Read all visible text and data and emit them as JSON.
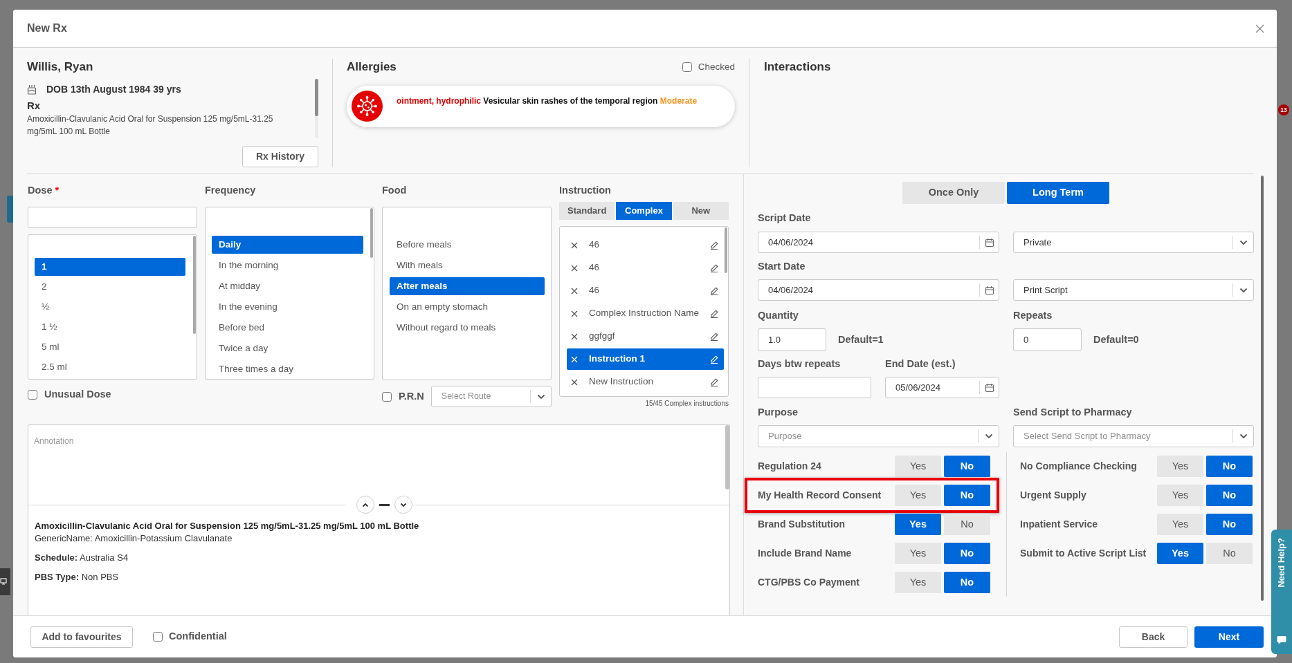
{
  "window": {
    "title": "New Rx"
  },
  "patient": {
    "name": "Willis, Ryan",
    "dob": "DOB 13th August 1984 39 yrs",
    "rx_heading": "Rx",
    "rx_description": "Amoxicillin-Clavulanic Acid Oral for Suspension 125 mg/5mL-31.25 mg/5mL 100 mL Bottle",
    "history_button": "Rx History"
  },
  "allergies": {
    "title": "Allergies",
    "checked_label": "Checked",
    "checked": false,
    "items": [
      {
        "substance": "ointment, hydrophilic",
        "reaction": "Vesicular skin rashes of the temporal region",
        "severity": "Moderate"
      }
    ]
  },
  "interactions": {
    "title": "Interactions"
  },
  "dose": {
    "label": "Dose",
    "required_mark": "*",
    "options": [
      {
        "label": "1",
        "selected": true
      },
      {
        "label": "2",
        "selected": false
      },
      {
        "label": "½",
        "selected": false
      },
      {
        "label": "1 ½",
        "selected": false
      },
      {
        "label": "5 ml",
        "selected": false
      },
      {
        "label": "2.5 ml",
        "selected": false
      }
    ],
    "unusual_label": "Unusual Dose",
    "unusual_checked": false
  },
  "frequency": {
    "label": "Frequency",
    "options": [
      {
        "label": "Daily",
        "selected": true
      },
      {
        "label": "In the morning",
        "selected": false
      },
      {
        "label": "At midday",
        "selected": false
      },
      {
        "label": "In the evening",
        "selected": false
      },
      {
        "label": "Before bed",
        "selected": false
      },
      {
        "label": "Twice a day",
        "selected": false
      },
      {
        "label": "Three times a day",
        "selected": false
      }
    ]
  },
  "food": {
    "label": "Food",
    "options": [
      {
        "label": "Before meals",
        "selected": false
      },
      {
        "label": "With meals",
        "selected": false
      },
      {
        "label": "After meals",
        "selected": true
      },
      {
        "label": "On an empty stomach",
        "selected": false
      },
      {
        "label": "Without regard to meals",
        "selected": false
      }
    ],
    "prn_label": "P.R.N",
    "prn_checked": false,
    "route_placeholder": "Select Route"
  },
  "instruction": {
    "label": "Instruction",
    "tabs": [
      {
        "label": "Standard",
        "selected": false
      },
      {
        "label": "Complex",
        "selected": true
      },
      {
        "label": "New",
        "selected": false
      }
    ],
    "items": [
      {
        "label": "46",
        "selected": false
      },
      {
        "label": "46",
        "selected": false
      },
      {
        "label": "46",
        "selected": false
      },
      {
        "label": "Complex Instruction Name",
        "selected": false
      },
      {
        "label": "ggfggf",
        "selected": false
      },
      {
        "label": "Instruction 1",
        "selected": true
      },
      {
        "label": "New Instruction",
        "selected": false
      }
    ],
    "count": "15/45 Complex instructions"
  },
  "annotation": {
    "placeholder": "Annotation"
  },
  "drug_info": {
    "name": "Amoxicillin-Clavulanic Acid Oral for Suspension 125 mg/5mL-31.25 mg/5mL 100 mL Bottle",
    "generic": "GenericName: Amoxicillin-Potassium Clavulanate",
    "details": [
      "**Schedule:** Australia S4",
      "**PBS Type:** Non PBS"
    ]
  },
  "term_tabs": [
    {
      "label": "Once Only",
      "selected": false
    },
    {
      "label": "Long Term",
      "selected": true
    }
  ],
  "script_date": {
    "label": "Script Date",
    "value": "04/06/2024"
  },
  "script_type": {
    "value": "Private"
  },
  "start_date": {
    "label": "Start Date",
    "value": "04/06/2024"
  },
  "delivery": {
    "value": "Print Script"
  },
  "quantity": {
    "label": "Quantity",
    "value": "1.0",
    "default_note": "Default=1"
  },
  "repeats": {
    "label": "Repeats",
    "value": "0",
    "default_note": "Default=0"
  },
  "days_between_repeats": {
    "label": "Days btw repeats"
  },
  "end_date": {
    "label": "End Date (est.)",
    "value": "05/06/2024"
  },
  "purpose": {
    "label": "Purpose",
    "placeholder": "Purpose"
  },
  "send_to_pharmacy": {
    "label": "Send Script to Pharmacy",
    "placeholder": "Select Send Script to Pharmacy"
  },
  "toggles_left": [
    {
      "label": "Regulation 24",
      "highlighted": false,
      "options": [
        {
          "label": "Yes",
          "selected": false
        },
        {
          "label": "No",
          "selected": true
        }
      ]
    },
    {
      "label": "My Health Record Consent",
      "highlighted": true,
      "options": [
        {
          "label": "Yes",
          "selected": false
        },
        {
          "label": "No",
          "selected": true
        }
      ]
    },
    {
      "label": "Brand Substitution",
      "highlighted": false,
      "options": [
        {
          "label": "Yes",
          "selected": true
        },
        {
          "label": "No",
          "selected": false
        }
      ]
    },
    {
      "label": "Include Brand Name",
      "highlighted": false,
      "options": [
        {
          "label": "Yes",
          "selected": false
        },
        {
          "label": "No",
          "selected": true
        }
      ]
    },
    {
      "label": "CTG/PBS Co Payment",
      "highlighted": false,
      "options": [
        {
          "label": "Yes",
          "selected": false
        },
        {
          "label": "No",
          "selected": true
        }
      ]
    }
  ],
  "toggles_right": [
    {
      "label": "No Compliance Checking",
      "highlighted": false,
      "options": [
        {
          "label": "Yes",
          "selected": false
        },
        {
          "label": "No",
          "selected": true
        }
      ]
    },
    {
      "label": "Urgent Supply",
      "highlighted": false,
      "options": [
        {
          "label": "Yes",
          "selected": false
        },
        {
          "label": "No",
          "selected": true
        }
      ]
    },
    {
      "label": "Inpatient Service",
      "highlighted": false,
      "options": [
        {
          "label": "Yes",
          "selected": false
        },
        {
          "label": "No",
          "selected": true
        }
      ]
    },
    {
      "label": "Submit to Active Script List",
      "highlighted": false,
      "options": [
        {
          "label": "Yes",
          "selected": true
        },
        {
          "label": "No",
          "selected": false
        }
      ]
    }
  ],
  "footer": {
    "favourites_button": "Add to favourites",
    "confidential_label": "Confidential",
    "confidential_checked": false,
    "back_button": "Back",
    "next_button": "Next"
  },
  "help_tab": {
    "label": "Need Help?"
  },
  "background": {
    "notification_count": "13"
  }
}
